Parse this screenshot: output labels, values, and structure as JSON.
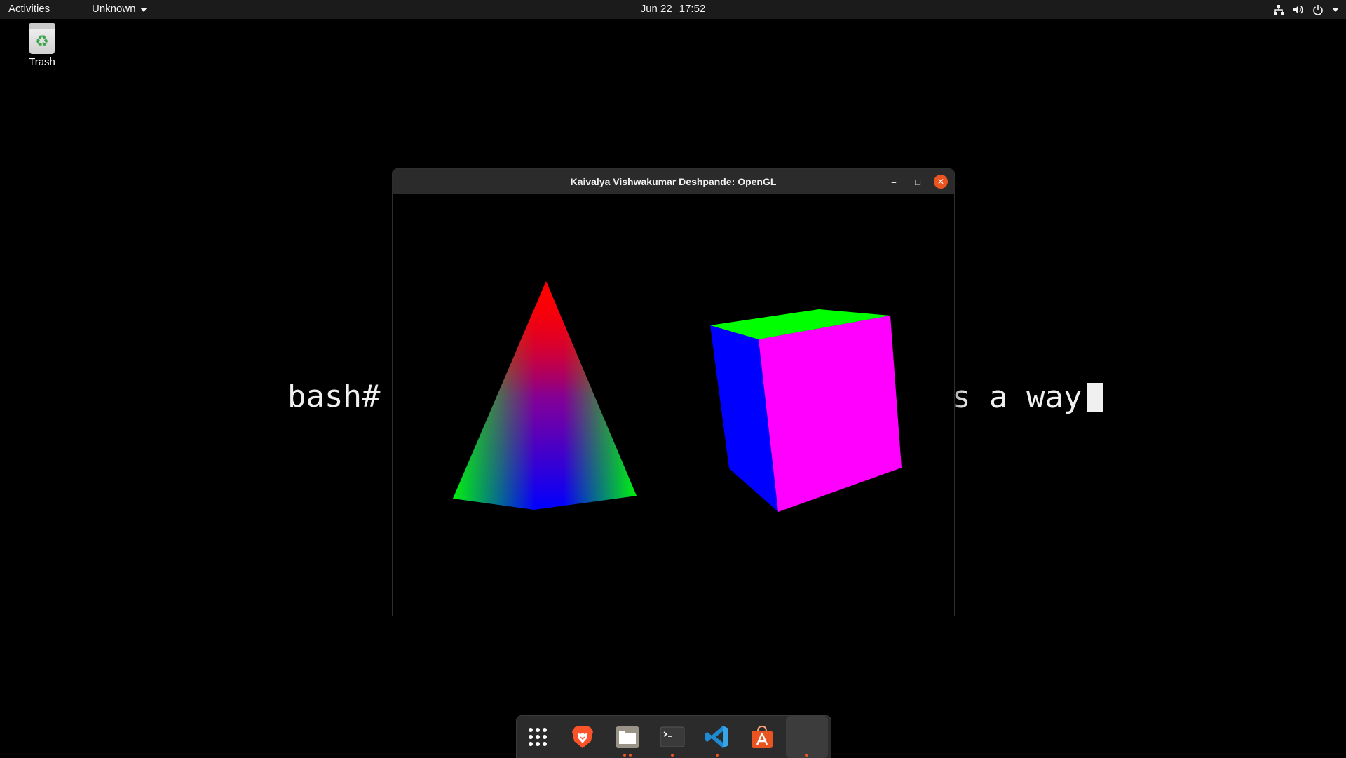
{
  "topbar": {
    "activities": "Activities",
    "app_menu": "Unknown",
    "date": "Jun 22",
    "time": "17:52",
    "tray_icons": [
      "network-icon",
      "volume-icon",
      "power-icon"
    ]
  },
  "desktop": {
    "trash_label": "Trash"
  },
  "terminal": {
    "prompt": "bash#",
    "tail_text": "s a way"
  },
  "gl_window": {
    "title": "Kaivalya Vishwakumar Deshpande: OpenGL",
    "minimize_glyph": "–",
    "maximize_glyph": "□",
    "close_glyph": "✕"
  },
  "dock": {
    "items": [
      {
        "name": "show-apps",
        "icon": "app-grid-icon",
        "running_dots": 0
      },
      {
        "name": "brave",
        "icon": "brave-lion-icon",
        "running_dots": 0
      },
      {
        "name": "files",
        "icon": "folder-icon",
        "running_dots": 2
      },
      {
        "name": "terminal",
        "icon": "terminal-icon",
        "running_dots": 1
      },
      {
        "name": "vscode",
        "icon": "vscode-icon",
        "running_dots": 1
      },
      {
        "name": "software",
        "icon": "app-store-icon",
        "running_dots": 0
      },
      {
        "name": "opengl-app",
        "icon": "blank-app-icon",
        "running_dots": 1
      }
    ]
  },
  "colors": {
    "accent": "#e95420",
    "pyramid_apex": "#ff0000",
    "pyramid_left": "#00ff00",
    "pyramid_front": "#0000ff",
    "cube_top": "#00ff00",
    "cube_left": "#0000ff",
    "cube_front": "#ff00ff"
  }
}
